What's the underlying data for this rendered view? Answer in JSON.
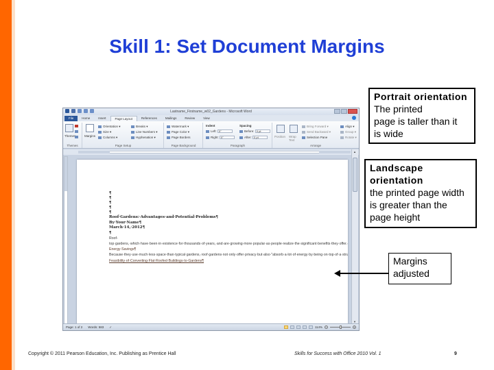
{
  "slide": {
    "title": "Skill 1: Set Document Margins",
    "accent_color": "#ff6600",
    "title_color": "#1f3fd6"
  },
  "word_window": {
    "title": "Lastname_Firstname_w02_Gardens - Microsoft Word",
    "quick_access": [
      "word-icon",
      "save-icon",
      "undo-icon",
      "redo-icon",
      "customize-icon"
    ],
    "tabs": [
      {
        "label": "File"
      },
      {
        "label": "Home"
      },
      {
        "label": "Insert"
      },
      {
        "label": "Page Layout"
      },
      {
        "label": "References"
      },
      {
        "label": "Mailings"
      },
      {
        "label": "Review"
      },
      {
        "label": "View"
      }
    ],
    "active_tab": "Page Layout",
    "ribbon": {
      "themes": {
        "label": "Themes",
        "button": "Themes"
      },
      "page_setup": {
        "label": "Page Setup",
        "margins": "Margins",
        "orientation": "Orientation",
        "size": "Size",
        "columns": "Columns",
        "breaks": "Breaks",
        "line_numbers": "Line Numbers",
        "hyphenation": "Hyphenation"
      },
      "page_background": {
        "label": "Page Background",
        "watermark": "Watermark",
        "page_color": "Page Color",
        "page_borders": "Page Borders"
      },
      "paragraph": {
        "label": "Paragraph",
        "indent_label": "Indent",
        "left_label": "Left:",
        "left_value": "0\"",
        "right_label": "Right:",
        "right_value": "0\"",
        "spacing_label": "Spacing",
        "before_label": "Before:",
        "before_value": "0 pt",
        "after_label": "After:",
        "after_value": "0 pt"
      },
      "arrange": {
        "label": "Arrange",
        "position": "Position",
        "wrap_text": "Wrap Text",
        "bring_forward": "Bring Forward",
        "send_backward": "Send Backward",
        "selection_pane": "Selection Pane",
        "align": "Align",
        "group": "Group",
        "rotate": "Rotate"
      }
    },
    "document": {
      "empty_paragraphs": [
        "¶",
        "¶",
        "¶",
        "¶",
        "¶"
      ],
      "title": "Roof·Gardens:·Advantages·and·Potential·Problems¶",
      "byline": "By·Your·Name¶",
      "date": "March·14,·2012¶",
      "blank": "¶",
      "para1": "Roof-top·gardens,·which·have·been·in·existence·for·thousands·of·years,·and·are·growing·more·popular·as·people·realize·the·significant·benefits·they·offer.·People·living·in·urban·areas,·apartments,·or·residences·with·small·gardening·spaces,·are·no·longer·limited·to·the·confines·of·their·environment.·Spaces·that·were·sparse·with·greenery·are·now·able·to·be·converted·into·roof·top·gardens·that·offer·more·than·just·a·beautiful·and·relaxing·environment.¶",
      "subhead1": "Energy·Savings¶",
      "para2": "Because·they·use·much·less·space·than·typical·gardens,·roof·gardens·not·only·offer·privacy·but·also·\"absorb·a·lot·of·energy·by·being·on·top·of·a·structure.·They·provide·natural·noise·and·thermal·heat·insulation,·thereby·cutting·down·on·utility·bills.\"·(Dickinson·2008)·Additionally,·roof·gardens·also·provide·habitats·for·wildlife.·Thus,·what·was·once·deemed·good·for·the·eye·is·also·now·good·for·the·environment.¶",
      "subhead2": "Feasibility·of·Converting·Flat·Roofed·Buildings·to·Gardens¶"
    },
    "status_bar": {
      "page": "Page: 1 of 2",
      "words": "Words: 583",
      "zoom": "114%",
      "zoom_fraction": 0.5
    }
  },
  "callouts": {
    "portrait": {
      "heading": "Portrait orientation",
      "body_line1": "The printed",
      "body_line2": "page is taller than it",
      "body_line3": "is wide"
    },
    "landscape": {
      "heading_line1": "Landscape",
      "heading_line2": "orientation",
      "body_line1": "the printed page width",
      "body_line2": "is greater than the",
      "body_line3": "page height"
    },
    "margins": {
      "line1": "Margins",
      "line2": "adjusted"
    }
  },
  "footer": {
    "copyright": "Copyright © 2011 Pearson Education, Inc. Publishing as Prentice Hall",
    "book": "Skills for Success with Office 2010 Vol. 1",
    "page_number": "9"
  }
}
